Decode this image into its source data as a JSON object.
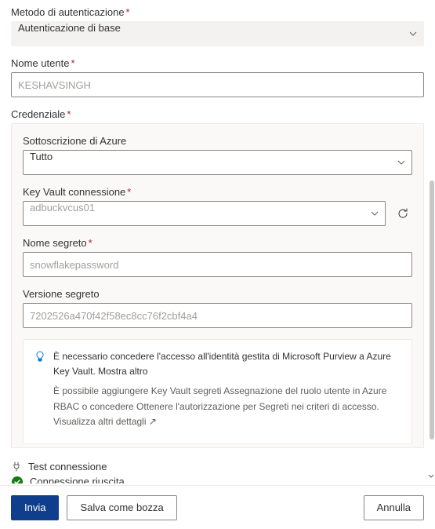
{
  "authMethod": {
    "label": "Metodo di autenticazione",
    "value": "Autenticazione di base"
  },
  "username": {
    "label": "Nome utente",
    "placeholder": "KESHAVSINGH"
  },
  "credential": {
    "label": "Credenziale",
    "subscription": {
      "label": "Sottoscrizione di Azure",
      "value": "Tutto"
    },
    "keyVault": {
      "label": "Key Vault connessione",
      "value": "adbuckvcus01"
    },
    "secretName": {
      "label": "Nome segreto",
      "placeholder": "snowflakepassword"
    },
    "secretVersion": {
      "label": "Versione segreto",
      "placeholder": "7202526a470f42f58ec8cc76f2cbf4a4"
    },
    "info": {
      "line1": "È necessario concedere l'accesso all'identità gestita di Microsoft Purview a Azure Key Vault. Mostra altro",
      "line2": "È possibile aggiungere Key Vault segreti Assegnazione del ruolo utente in Azure RBAC o concedere Ottenere l'autorizzazione per Segreti nei criteri di accesso. Visualizza altri dettagli ↗"
    }
  },
  "testConnection": {
    "label": "Test connessione",
    "status": "Connessione riuscita. ..."
  },
  "footer": {
    "submit": "Invia",
    "saveDraft": "Salva come bozza",
    "cancel": "Annulla"
  },
  "asterisk": "*"
}
